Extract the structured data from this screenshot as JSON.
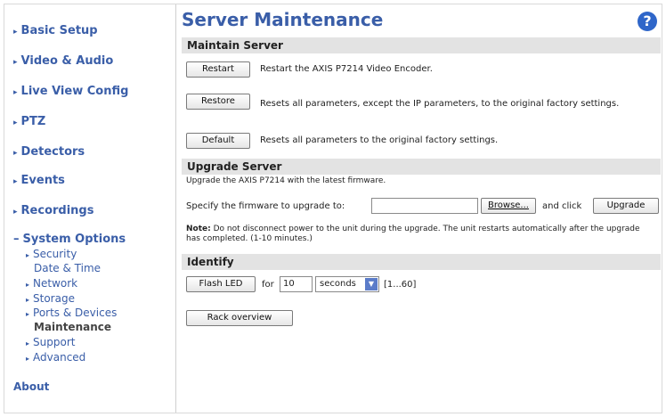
{
  "sidebar": {
    "items": [
      {
        "label": "Basic Setup"
      },
      {
        "label": "Video & Audio"
      },
      {
        "label": "Live View Config"
      },
      {
        "label": "PTZ"
      },
      {
        "label": "Detectors"
      },
      {
        "label": "Events"
      },
      {
        "label": "Recordings"
      },
      {
        "label": "System Options"
      }
    ],
    "sub_items": [
      {
        "label": "Security"
      },
      {
        "label": "Date & Time"
      },
      {
        "label": "Network"
      },
      {
        "label": "Storage"
      },
      {
        "label": "Ports & Devices"
      },
      {
        "label": "Maintenance"
      },
      {
        "label": "Support"
      },
      {
        "label": "Advanced"
      }
    ],
    "about": "About"
  },
  "page": {
    "title": "Server Maintenance",
    "help": "?"
  },
  "maintain": {
    "header": "Maintain Server",
    "restart_button": "Restart",
    "restart_desc": "Restart the AXIS P7214 Video Encoder.",
    "restore_button": "Restore",
    "restore_desc": "Resets all parameters, except the IP parameters, to the original factory settings.",
    "default_button": "Default",
    "default_desc": "Resets all parameters to the original factory settings."
  },
  "upgrade": {
    "header": "Upgrade Server",
    "intro": "Upgrade the AXIS P7214 with the latest firmware.",
    "specify_label": "Specify the firmware to upgrade to:",
    "file_value": "",
    "browse_button": "Browse...",
    "and_click": "and click",
    "upgrade_button": "Upgrade",
    "note_label": "Note:",
    "note_text": "Do not disconnect power to the unit during the upgrade. The unit restarts automatically after the upgrade has completed. (1-10 minutes.)"
  },
  "identify": {
    "header": "Identify",
    "flash_button": "Flash LED",
    "for_label": "for",
    "duration_value": "10",
    "unit_selected": "seconds",
    "range": "[1...60]",
    "rack_button": "Rack overview"
  }
}
